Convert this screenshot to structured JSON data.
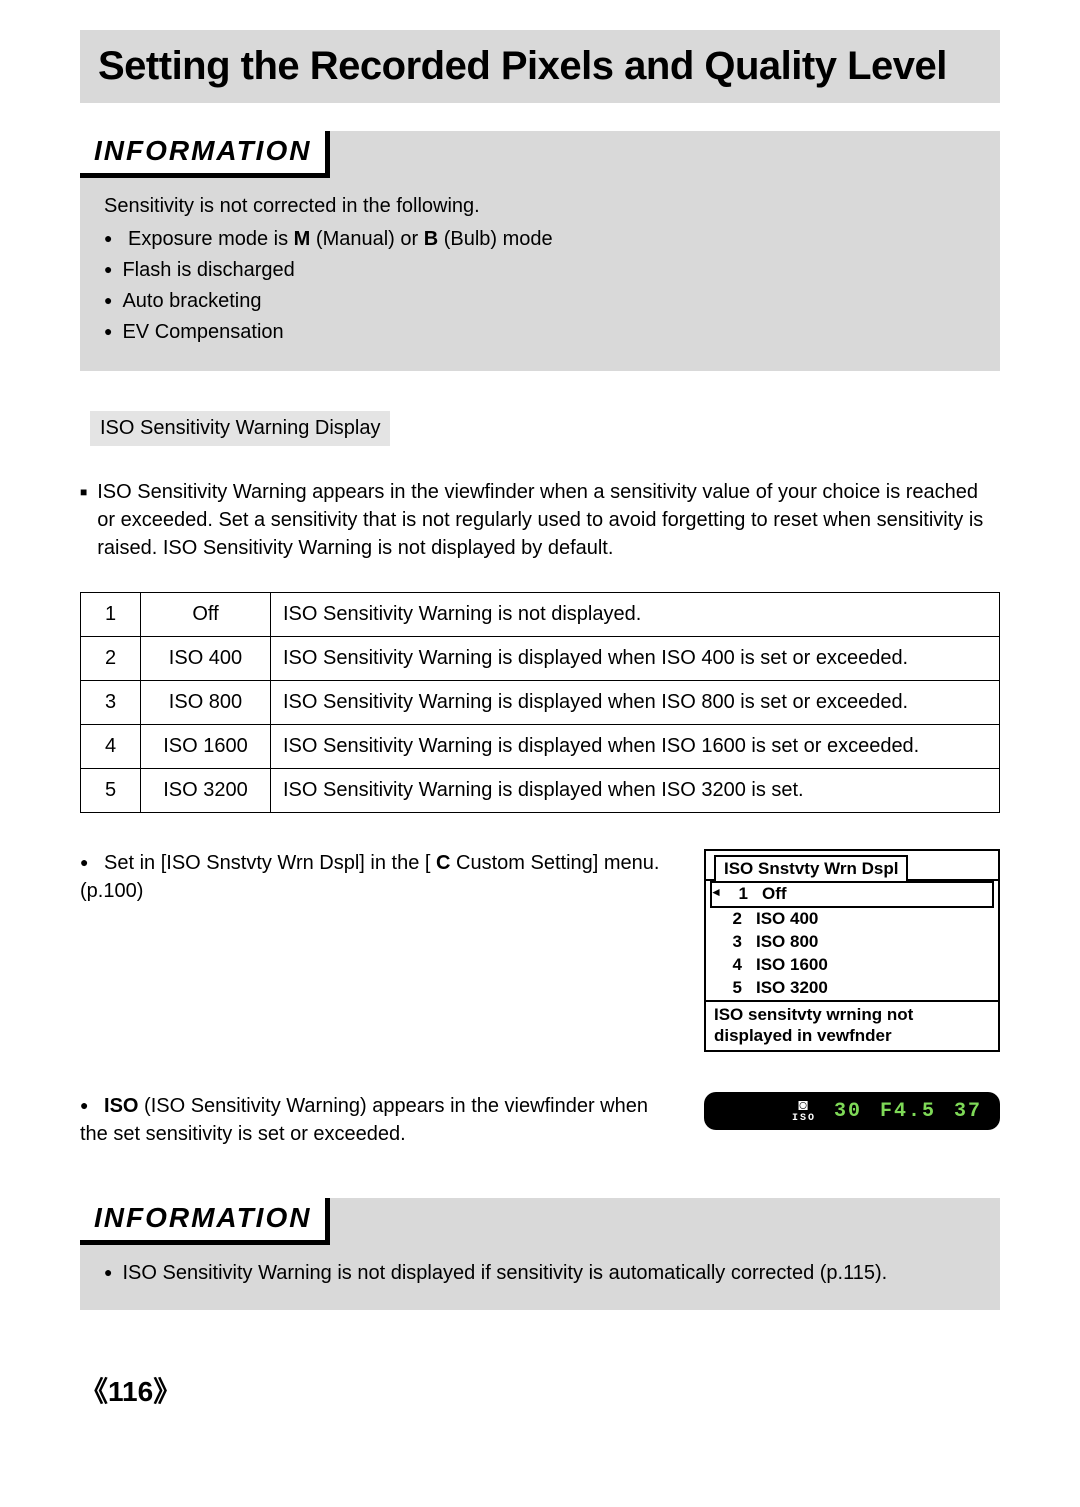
{
  "title": "Setting the Recorded Pixels and Quality Level",
  "info1": {
    "heading": "INFORMATION",
    "intro": "Sensitivity is not corrected in the following.",
    "items": [
      {
        "pre": "Exposure mode is ",
        "icon1": "M",
        "mid1": " (Manual) or ",
        "icon2": "B",
        "mid2": " (Bulb) mode"
      },
      {
        "pre": "Flash is discharged"
      },
      {
        "pre": "Auto bracketing"
      },
      {
        "pre": "EV Compensation"
      }
    ]
  },
  "subheading": "ISO Sensitivity Warning Display",
  "para1": "ISO Sensitivity Warning appears in the viewfinder when a sensitivity value of your choice is reached or exceeded. Set a sensitivity that is not regularly used to avoid forgetting to reset when sensitivity is raised. ISO Sensitivity Warning is not displayed by default.",
  "table": [
    {
      "n": "1",
      "v": "Off",
      "d": "ISO Sensitivity Warning is not displayed."
    },
    {
      "n": "2",
      "v": "ISO 400",
      "d": "ISO Sensitivity Warning is displayed when ISO 400 is set or exceeded."
    },
    {
      "n": "3",
      "v": "ISO 800",
      "d": "ISO Sensitivity Warning is displayed when ISO 800 is set or exceeded."
    },
    {
      "n": "4",
      "v": "ISO 1600",
      "d": "ISO Sensitivity Warning is displayed when ISO 1600 is set or exceeded."
    },
    {
      "n": "5",
      "v": "ISO 3200",
      "d": "ISO Sensitivity Warning is displayed when ISO 3200 is set."
    }
  ],
  "setin": {
    "pre": "Set in [ISO Snstvty Wrn Dspl] in the [ ",
    "icon": "C",
    "post": " Custom Setting] menu. (p.100)"
  },
  "menu": {
    "tab": "ISO Snstvty Wrn Dspl",
    "rows": [
      {
        "n": "1",
        "label": "Off",
        "selected": true
      },
      {
        "n": "2",
        "label": "ISO 400"
      },
      {
        "n": "3",
        "label": "ISO 800"
      },
      {
        "n": "4",
        "label": "ISO 1600"
      },
      {
        "n": "5",
        "label": "ISO 3200"
      }
    ],
    "footer1": "ISO sensitvty wrning not",
    "footer2": "displayed in vewfnder"
  },
  "isoline": {
    "icon": "ISO",
    "text": " (ISO Sensitivity Warning) appears in the viewfinder when the set sensitivity is set or exceeded."
  },
  "viewfinder": {
    "shutter": "30",
    "aperture": "F4.5",
    "count": "37"
  },
  "info2": {
    "heading": "INFORMATION",
    "item": "ISO Sensitivity Warning is not displayed if sensitivity is automatically corrected (p.115)."
  },
  "pagenum": "116"
}
